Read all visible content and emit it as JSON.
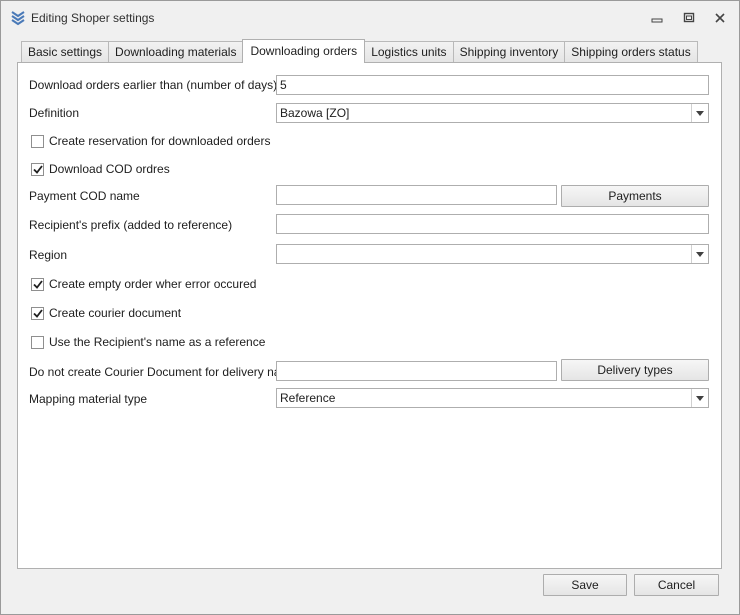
{
  "window": {
    "title": "Editing Shoper settings"
  },
  "tabs": [
    {
      "label": "Basic settings"
    },
    {
      "label": "Downloading materials"
    },
    {
      "label": "Downloading orders"
    },
    {
      "label": "Logistics units"
    },
    {
      "label": "Shipping inventory"
    },
    {
      "label": "Shipping orders status"
    }
  ],
  "form": {
    "days_label": "Download orders earlier than (number of days)",
    "days_value": "5",
    "definition_label": "Definition",
    "definition_value": "Bazowa [ZO]",
    "reservation_label": "Create reservation for downloaded orders",
    "reservation_checked": false,
    "cod_label": "Download COD ordres",
    "cod_checked": true,
    "payment_cod_label": "Payment COD name",
    "payment_cod_value": "",
    "payments_button": "Payments",
    "prefix_label": "Recipient's prefix (added to reference)",
    "prefix_value": "",
    "region_label": "Region",
    "region_value": "",
    "empty_order_label": "Create empty order wher error occured",
    "empty_order_checked": true,
    "courier_doc_label": "Create courier document",
    "courier_doc_checked": true,
    "recipient_name_label": "Use the Recipient's name as a reference",
    "recipient_name_checked": false,
    "no_courier_label": "Do not create Courier Document for delivery name",
    "no_courier_value": "",
    "delivery_types_button": "Delivery types",
    "mapping_label": "Mapping material type",
    "mapping_value": "Reference"
  },
  "footer": {
    "save_label": "Save",
    "cancel_label": "Cancel"
  }
}
